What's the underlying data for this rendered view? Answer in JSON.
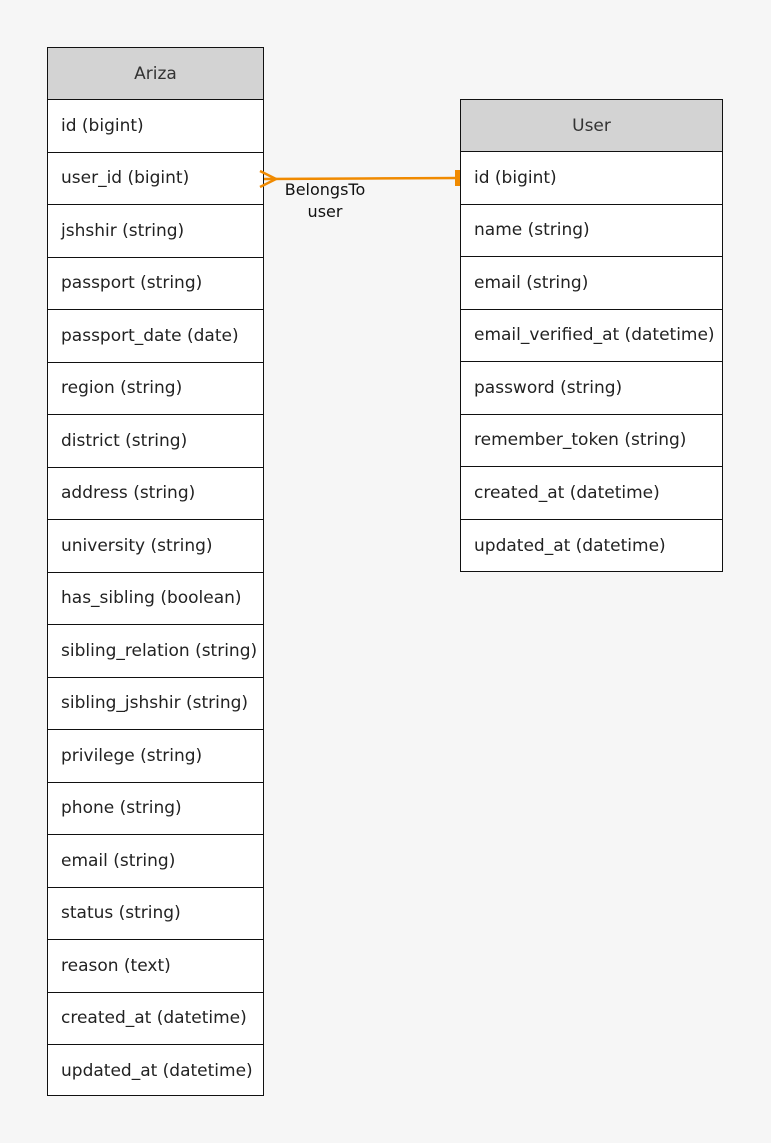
{
  "entities": {
    "ariza": {
      "title": "Ariza",
      "fields": [
        "id (bigint)",
        "user_id (bigint)",
        "jshshir (string)",
        "passport (string)",
        "passport_date (date)",
        "region (string)",
        "district (string)",
        "address (string)",
        "university (string)",
        "has_sibling (boolean)",
        "sibling_relation (string)",
        "sibling_jshshir (string)",
        "privilege (string)",
        "phone (string)",
        "email (string)",
        "status (string)",
        "reason (text)",
        "created_at (datetime)",
        "updated_at (datetime)"
      ]
    },
    "user": {
      "title": "User",
      "fields": [
        "id (bigint)",
        "name (string)",
        "email (string)",
        "email_verified_at (datetime)",
        "password (string)",
        "remember_token (string)",
        "created_at (datetime)",
        "updated_at (datetime)"
      ]
    }
  },
  "relation": {
    "type": "BelongsTo",
    "name": "user",
    "color": "#f08a00"
  },
  "colors": {
    "background": "#f6f6f6",
    "header": "#d3d3d3"
  }
}
